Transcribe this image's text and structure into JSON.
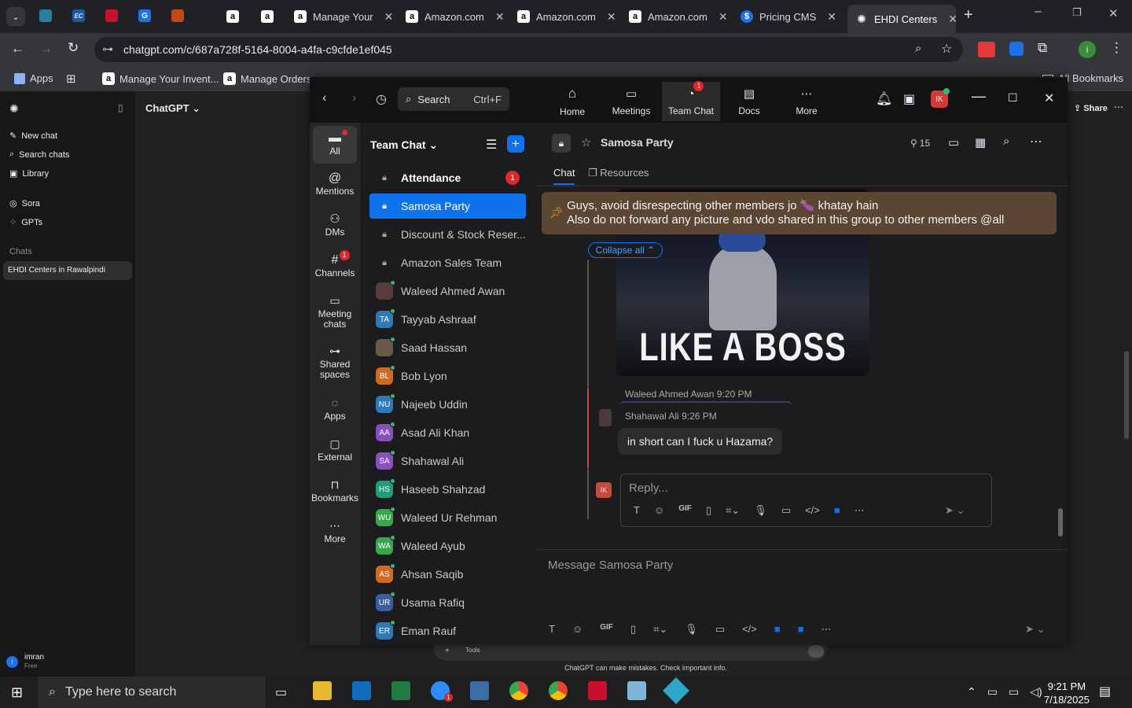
{
  "browser": {
    "tabs": [
      {
        "title": "",
        "icon": "amazon-icon"
      },
      {
        "title": "",
        "icon": "amazon-icon"
      },
      {
        "title": "Manage Your",
        "icon": "amazon-icon"
      },
      {
        "title": "Amazon.com",
        "icon": "amazon-icon"
      },
      {
        "title": "Amazon.com",
        "icon": "amazon-icon"
      },
      {
        "title": "Amazon.com",
        "icon": "amazon-icon"
      },
      {
        "title": "Pricing CMS",
        "icon": "dollar-icon"
      },
      {
        "title": "EHDI Centers",
        "icon": "openai-icon"
      }
    ],
    "url": "chatgpt.com/c/687a728f-5164-8004-a4fa-c9cfde1ef045",
    "bookmarks": [
      "Apps",
      "Manage Your Invent...",
      "Manage Orders",
      "All Bookmarks"
    ]
  },
  "chatgpt": {
    "model": "ChatGPT",
    "sidebar": [
      "New chat",
      "Search chats",
      "Library",
      "Sora",
      "GPTs"
    ],
    "section": "Chats",
    "chat_item": "EHDI Centers in Rawalpindi",
    "share": "Share",
    "user": "imran",
    "plan": "Free",
    "disclaimer": "ChatGPT can make mistakes. Check important info.",
    "tools": "Tools"
  },
  "zoom": {
    "search_label": "Search",
    "search_shortcut": "Ctrl+F",
    "nav": [
      {
        "label": "Home",
        "icon": "home-icon"
      },
      {
        "label": "Meetings",
        "icon": "video-icon"
      },
      {
        "label": "Team Chat",
        "icon": "chat-icon",
        "badge": "1"
      },
      {
        "label": "Docs",
        "icon": "docs-icon"
      },
      {
        "label": "More",
        "icon": "more-icon"
      }
    ],
    "avatar_initials": "IK",
    "rail": [
      {
        "label": "All"
      },
      {
        "label": "Mentions"
      },
      {
        "label": "DMs"
      },
      {
        "label": "Channels",
        "badge": "1"
      },
      {
        "label": "Meeting chats"
      },
      {
        "label": "Shared spaces"
      },
      {
        "label": "Apps"
      },
      {
        "label": "External"
      },
      {
        "label": "Bookmarks"
      },
      {
        "label": "More"
      }
    ],
    "list_title": "Team Chat",
    "list": [
      {
        "name": "Attendance",
        "type": "lock",
        "badge": "1",
        "bold": true
      },
      {
        "name": "Samosa Party",
        "type": "lock",
        "selected": true
      },
      {
        "name": "Discount & Stock Reser...",
        "type": "lock"
      },
      {
        "name": "Amazon Sales Team",
        "type": "lock"
      },
      {
        "name": "Waleed Ahmed Awan",
        "initials": "",
        "color": "#5a3a3a"
      },
      {
        "name": "Tayyab Ashraaf",
        "initials": "TA",
        "color": "#2e7ab8"
      },
      {
        "name": "Saad Hassan",
        "initials": "",
        "color": "#6a5a4a"
      },
      {
        "name": "Bob Lyon",
        "initials": "BL",
        "color": "#d2691e"
      },
      {
        "name": "Najeeb Uddin",
        "initials": "NU",
        "color": "#2e7ab8"
      },
      {
        "name": "Asad Ali Khan",
        "initials": "AA",
        "color": "#8a4fbf"
      },
      {
        "name": "Shahawal Ali",
        "initials": "SA",
        "color": "#8a4fbf"
      },
      {
        "name": "Haseeb Shahzad",
        "initials": "HS",
        "color": "#1f9e7a"
      },
      {
        "name": "Waleed Ur Rehman",
        "initials": "WU",
        "color": "#3aa84a"
      },
      {
        "name": "Waleed Ayub",
        "initials": "WA",
        "color": "#3aa84a"
      },
      {
        "name": "Ahsan Saqib",
        "initials": "AS",
        "color": "#d2691e"
      },
      {
        "name": "Usama Rafiq",
        "initials": "UR",
        "color": "#3a5fa0"
      },
      {
        "name": "Eman Rauf",
        "initials": "ER",
        "color": "#2e7ab8"
      }
    ],
    "channel_name": "Samosa Party",
    "member_count": "15",
    "tabs": [
      "Chat",
      "Resources"
    ],
    "pinned": "Guys, avoid disrespecting other members jo 🍆 khatay hain\nAlso do not forward any picture and vdo shared in this group to other members @all",
    "collapse": "Collapse all",
    "gif_caption": "LIKE A BOSS",
    "thread_author": "Waleed Ahmed Awan",
    "thread_time": "9:20 PM",
    "reply_author": "Shahawal Ali",
    "reply_time": "9:26 PM",
    "reply_text": "in short can I fuck u Hazama?",
    "reply_placeholder": "Reply...",
    "message_placeholder": "Message Samosa Party"
  },
  "taskbar": {
    "search": "Type here to search",
    "time": "9:21 PM",
    "date": "7/18/2025",
    "notif": "1"
  }
}
